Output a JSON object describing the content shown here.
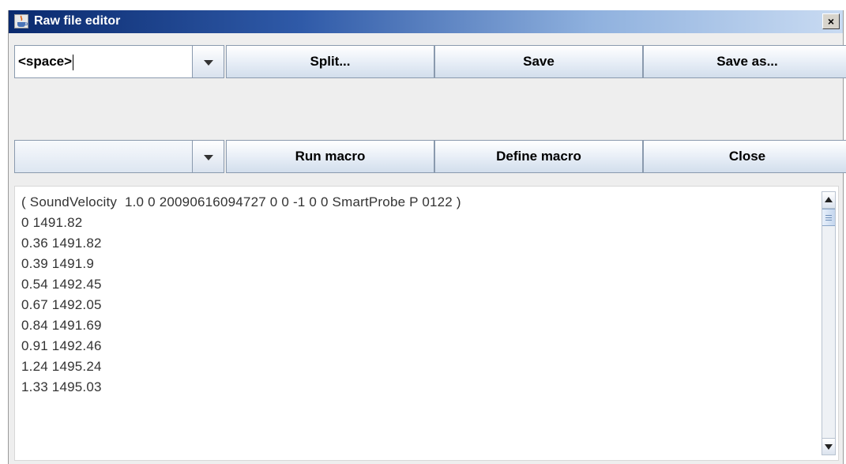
{
  "window": {
    "title": "Raw file editor",
    "close_glyph": "×"
  },
  "toolbar1": {
    "delimiter_value": "<space>",
    "split_label": "Split...",
    "save_label": "Save",
    "save_as_label": "Save as..."
  },
  "toolbar2": {
    "macro_value": "",
    "run_macro_label": "Run macro",
    "define_macro_label": "Define macro",
    "close_label": "Close"
  },
  "editor": {
    "lines": [
      "( SoundVelocity  1.0 0 20090616094727 0 0 -1 0 0 SmartProbe P 0122 )",
      "0 1491.82",
      "0.36 1491.82",
      "0.39 1491.9",
      "0.54 1492.45",
      "0.67 1492.05",
      "0.84 1491.69",
      "0.91 1492.46",
      "1.24 1495.24",
      "1.33 1495.03"
    ]
  },
  "icons": {
    "app": "java-app-icon",
    "dropdown": "chevron-down-icon",
    "scroll_up": "arrow-up-icon",
    "scroll_down": "arrow-down-icon"
  },
  "colors": {
    "titlebar_start": "#0a2a6e",
    "titlebar_end": "#c9dbf2",
    "window_bg": "#eeeeee"
  }
}
